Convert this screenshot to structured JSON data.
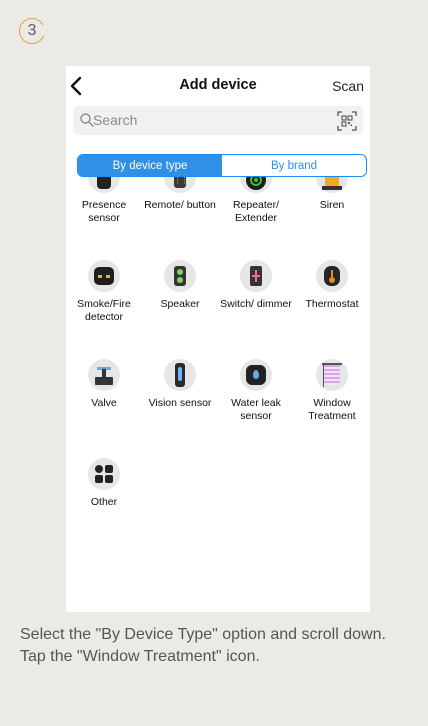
{
  "step": {
    "number": "3"
  },
  "header": {
    "title": "Add device",
    "scan_label": "Scan"
  },
  "search": {
    "placeholder": "Search"
  },
  "segments": {
    "by_type": "By device type",
    "by_brand": "By brand"
  },
  "devices": [
    {
      "label": "Presence sensor",
      "icon": "presence-sensor-icon"
    },
    {
      "label": "Remote/ button",
      "icon": "remote-icon"
    },
    {
      "label": "Repeater/ Extender",
      "icon": "repeater-icon"
    },
    {
      "label": "Siren",
      "icon": "siren-icon"
    },
    {
      "label": "Smoke/Fire detector",
      "icon": "smoke-detector-icon"
    },
    {
      "label": "Speaker",
      "icon": "speaker-icon"
    },
    {
      "label": "Switch/ dimmer",
      "icon": "switch-icon"
    },
    {
      "label": "Thermostat",
      "icon": "thermostat-icon"
    },
    {
      "label": "Valve",
      "icon": "valve-icon"
    },
    {
      "label": "Vision sensor",
      "icon": "vision-sensor-icon"
    },
    {
      "label": "Water leak sensor",
      "icon": "water-leak-icon"
    },
    {
      "label": "Window Treatment",
      "icon": "window-treatment-icon"
    },
    {
      "label": "Other",
      "icon": "other-icon"
    }
  ],
  "caption": {
    "text": "Select the \"By Device Type\" option and scroll down. Tap the \"Window Treatment\" icon."
  },
  "colors": {
    "accent": "#2f90e6",
    "badge": "#e9a13b",
    "background": "#ebeae7"
  }
}
